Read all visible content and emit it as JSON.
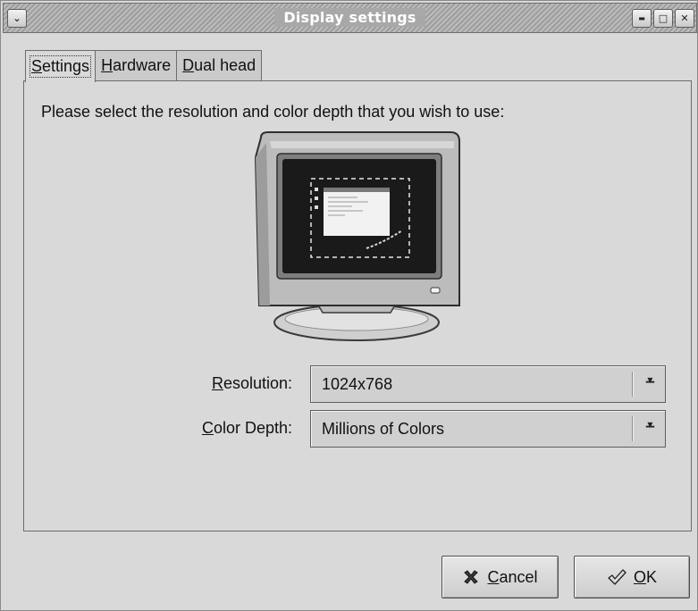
{
  "window": {
    "title": "Display settings",
    "controls": {
      "menu": "⌄",
      "minimize": "▬",
      "maximize": "□",
      "close": "✕"
    }
  },
  "tabs": [
    {
      "mnemonic": "S",
      "rest": "ettings",
      "active": true
    },
    {
      "mnemonic": "H",
      "rest": "ardware",
      "active": false
    },
    {
      "mnemonic": "D",
      "rest": "ual head",
      "active": false
    }
  ],
  "settings": {
    "prompt": "Please select the resolution and color depth that you wish to use:",
    "resolution": {
      "mnemonic": "R",
      "rest": "esolution:",
      "value": "1024x768"
    },
    "color_depth": {
      "mnemonic": "C",
      "rest": "olor Depth:",
      "value": "Millions of Colors"
    }
  },
  "buttons": {
    "cancel": {
      "mnemonic": "C",
      "rest": "ancel",
      "icon": "x-mark-icon"
    },
    "ok": {
      "mnemonic": "O",
      "rest": "K",
      "icon": "checkmark-icon"
    }
  },
  "colors": {
    "window_bg": "#d9d9d9",
    "border": "#6c6c6c",
    "screen": "#1a1a1a"
  }
}
